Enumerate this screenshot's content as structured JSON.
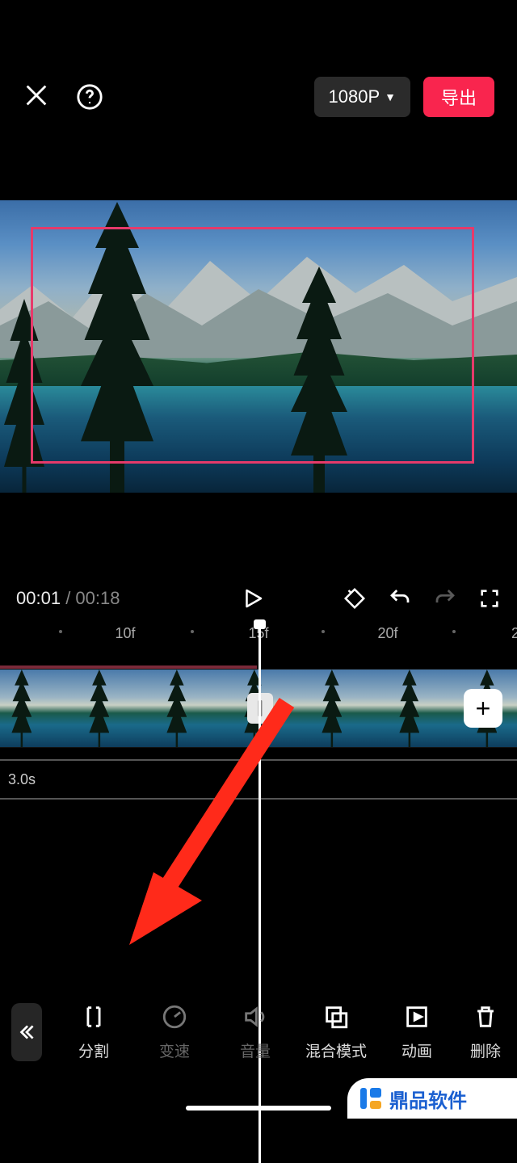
{
  "header": {
    "resolution_label": "1080P",
    "export_label": "导出"
  },
  "playback": {
    "current_time": "00:01",
    "total_time": "00:18"
  },
  "timeline": {
    "ruler_marks": [
      "10f",
      "15f",
      "20f"
    ],
    "audio_duration_label": "3.0s"
  },
  "toolbar": {
    "items": [
      {
        "id": "split",
        "label": "分割",
        "dim": false
      },
      {
        "id": "speed",
        "label": "变速",
        "dim": true
      },
      {
        "id": "volume",
        "label": "音量",
        "dim": true
      },
      {
        "id": "blend",
        "label": "混合模式",
        "dim": false
      },
      {
        "id": "anim",
        "label": "动画",
        "dim": false
      },
      {
        "id": "delete",
        "label": "删除",
        "dim": false
      }
    ]
  },
  "watermark": {
    "text": "鼎品软件"
  }
}
